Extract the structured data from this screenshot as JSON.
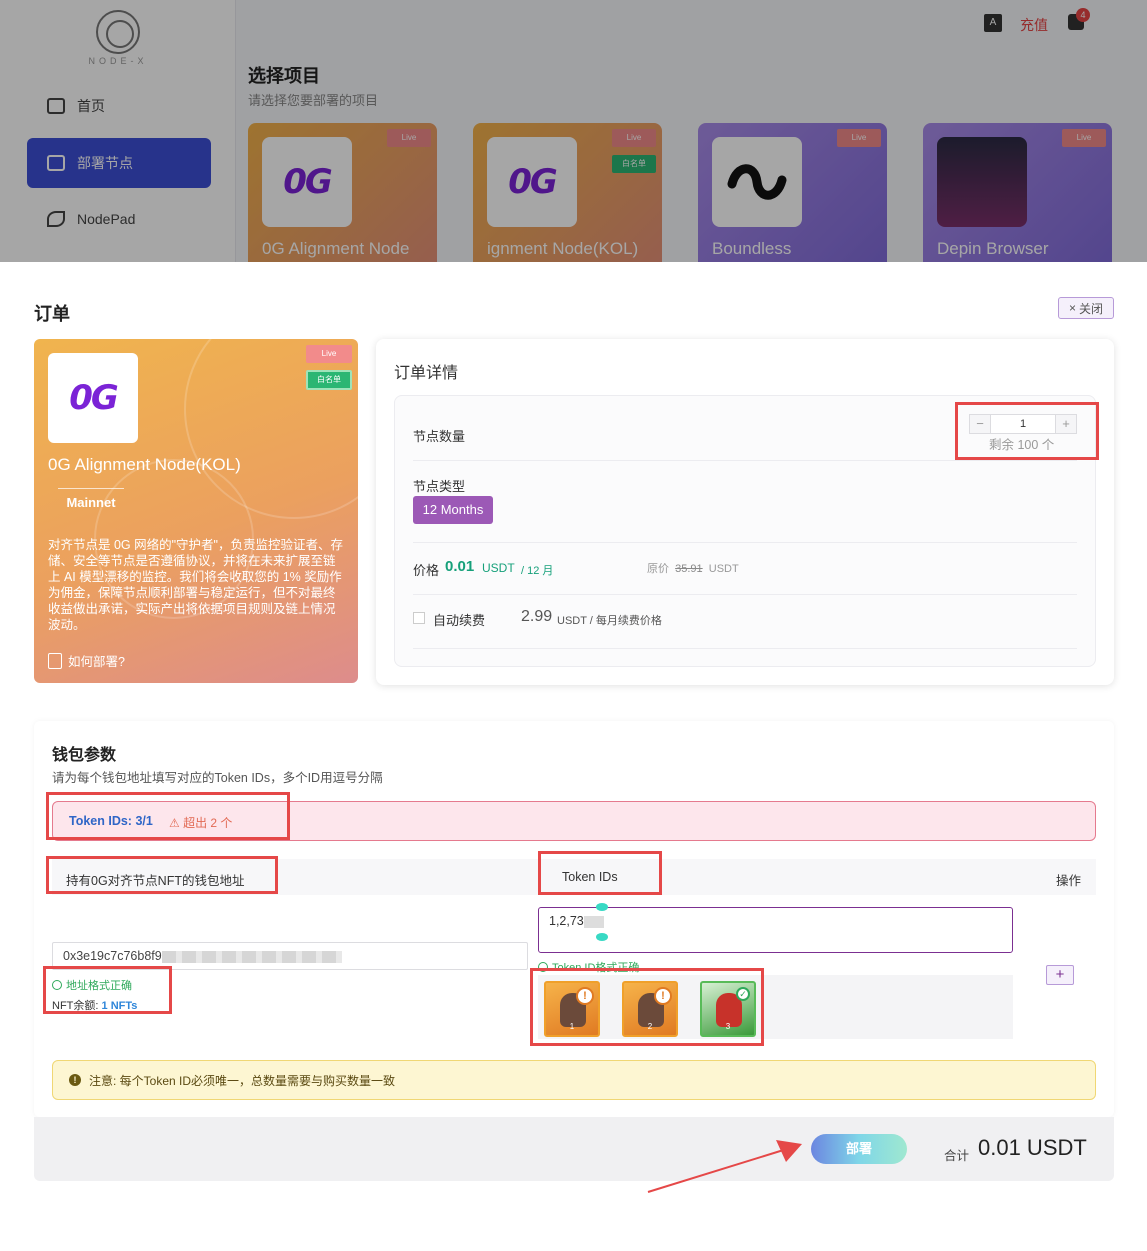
{
  "app": {
    "logo_text": "NODE-X",
    "recharge": "充值",
    "msg_badge": "4",
    "translate_icon": "translate-icon"
  },
  "sidebar": {
    "items": [
      {
        "label": "首页"
      },
      {
        "label": "部署节点"
      },
      {
        "label": "NodePad"
      }
    ]
  },
  "page": {
    "title": "选择项目",
    "subtitle": "请选择您要部署的项目"
  },
  "projects": [
    {
      "name": "0G Alignment Node",
      "badge": "Live"
    },
    {
      "name": "ignment Node(KOL)",
      "badge": "Live",
      "whitelist": "白名单"
    },
    {
      "name": "Boundless",
      "badge": "Live"
    },
    {
      "name": "Depin Browser",
      "badge": "Live"
    }
  ],
  "modal": {
    "title": "订单",
    "close": "关闭",
    "product": {
      "logo": "0G",
      "live": "Live",
      "whitelist": "白名单",
      "name": "0G Alignment Node(KOL)",
      "network": "Mainnet",
      "desc": "对齐节点是 0G 网络的\"守护者\"，负责监控验证者、存储、安全等节点是否遵循协议，并将在未来扩展至链上 AI 模型漂移的监控。我们将会收取您的 1% 奖励作为佣金，保障节点顺利部署与稳定运行，但不对最终收益做出承诺，实际产出将依据项目规则及链上情况波动。",
      "how": "如何部署?"
    },
    "order": {
      "title": "订单详情",
      "qty_label": "节点数量",
      "qty_value": "1",
      "minus": "−",
      "plus": "+",
      "remaining": "剩余 100 个",
      "type_label": "节点类型",
      "type_value": "12 Months",
      "price_label": "价格",
      "price_value": "0.01",
      "price_unit": "USDT",
      "price_per": "/ 12 月",
      "orig_label": "原价",
      "orig_value": "35.91",
      "orig_unit": "USDT",
      "renew_label": "自动续费",
      "renew_value": "2.99",
      "renew_unit": "USDT /",
      "renew_desc": "每月续费价格"
    },
    "wallet": {
      "title": "钱包参数",
      "subtitle": "请为每个钱包地址填写对应的Token IDs，多个ID用逗号分隔",
      "token_count": "Token IDs: 3/1",
      "token_warn": "超出 2 个",
      "col_address": "持有0G对齐节点NFT的钱包地址",
      "col_ids": "Token IDs",
      "col_action": "操作",
      "address_value": "0x3e19c7c76b8f9",
      "address_ok": "地址格式正确",
      "nft_balance_label": "NFT余额:",
      "nft_balance_value": "1 NFTs",
      "ids_value": "1,2,73",
      "ids_ok": "Token ID格式正确",
      "nfts": [
        {
          "num": "1"
        },
        {
          "num": "2"
        },
        {
          "num": "3"
        }
      ],
      "add": "+",
      "notice": "注意: 每个Token ID必须唯一，总数量需要与购买数量一致"
    },
    "footer": {
      "deploy": "部署",
      "total_label": "合计",
      "total_value": "0.01 USDT"
    }
  }
}
